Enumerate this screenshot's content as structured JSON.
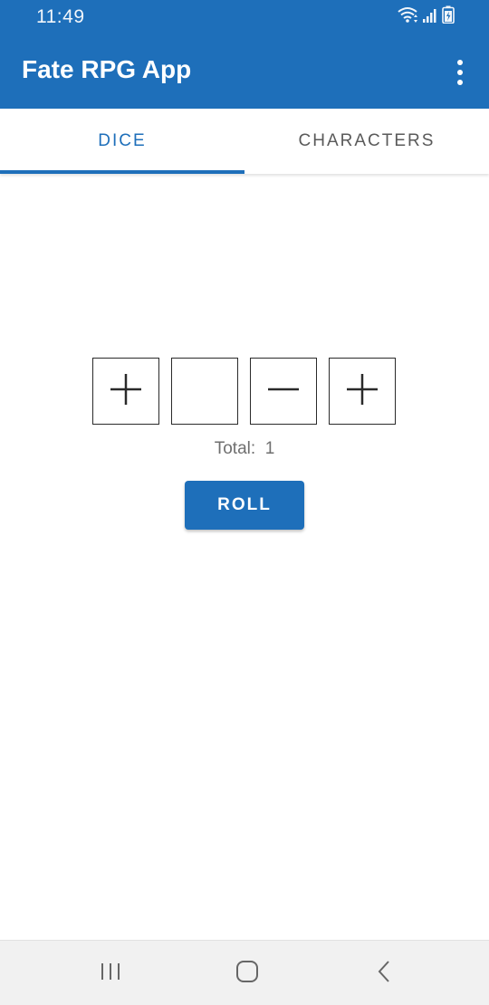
{
  "status_bar": {
    "time": "11:49",
    "icons": [
      "wifi-icon",
      "signal-icon",
      "battery-charging-icon"
    ]
  },
  "app_bar": {
    "title": "Fate RPG App",
    "overflow_icon": "more-vert-icon"
  },
  "tabs": [
    {
      "label": "DICE",
      "active": true
    },
    {
      "label": "CHARACTERS",
      "active": false
    }
  ],
  "dice": {
    "faces": [
      "+",
      "blank",
      "−",
      "+"
    ],
    "total_label": "Total:",
    "total_value": "1"
  },
  "roll_button": {
    "label": "ROLL"
  },
  "nav_bar": {
    "icons": [
      "recent-apps-icon",
      "home-icon",
      "back-icon"
    ]
  },
  "colors": {
    "primary": "#1e6fba",
    "tab_inactive": "#5a5a5a",
    "total_text": "#6f6f6f",
    "nav_bar_bg": "#f1f1f1"
  }
}
